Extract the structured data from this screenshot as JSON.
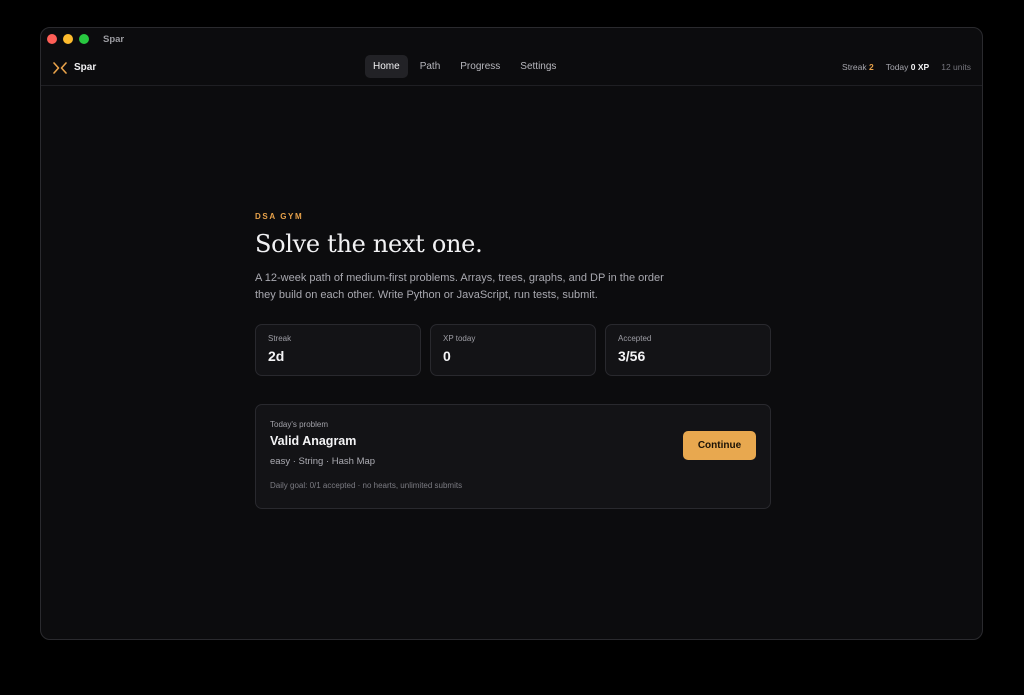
{
  "window": {
    "title": "Spar"
  },
  "nav": {
    "brand": "Spar",
    "tabs": [
      {
        "label": "Home",
        "active": true
      },
      {
        "label": "Path",
        "active": false
      },
      {
        "label": "Progress",
        "active": false
      },
      {
        "label": "Settings",
        "active": false
      }
    ],
    "streak_label": "Streak",
    "streak_value": "2",
    "today_label": "Today",
    "today_value": "0 XP",
    "units": "12 units"
  },
  "hero": {
    "eyebrow": "DSA GYM",
    "headline": "Solve the next one.",
    "description": "A 12-week path of medium-first problems. Arrays, trees, graphs, and DP in the order they build on each other. Write Python or JavaScript, run tests, submit."
  },
  "stats": [
    {
      "label": "Streak",
      "value": "2d"
    },
    {
      "label": "XP today",
      "value": "0"
    },
    {
      "label": "Accepted",
      "value": "3/56"
    }
  ],
  "problem": {
    "label": "Today's problem",
    "title": "Valid Anagram",
    "tags": "easy · String · Hash Map",
    "goal": "Daily goal: 0/1 accepted · no hearts, unlimited submits",
    "button": "Continue"
  },
  "colors": {
    "accent": "#e8a24a",
    "background": "#0c0c0e",
    "card": "#131316"
  },
  "icons": {
    "brand": "spar-logo-icon"
  }
}
